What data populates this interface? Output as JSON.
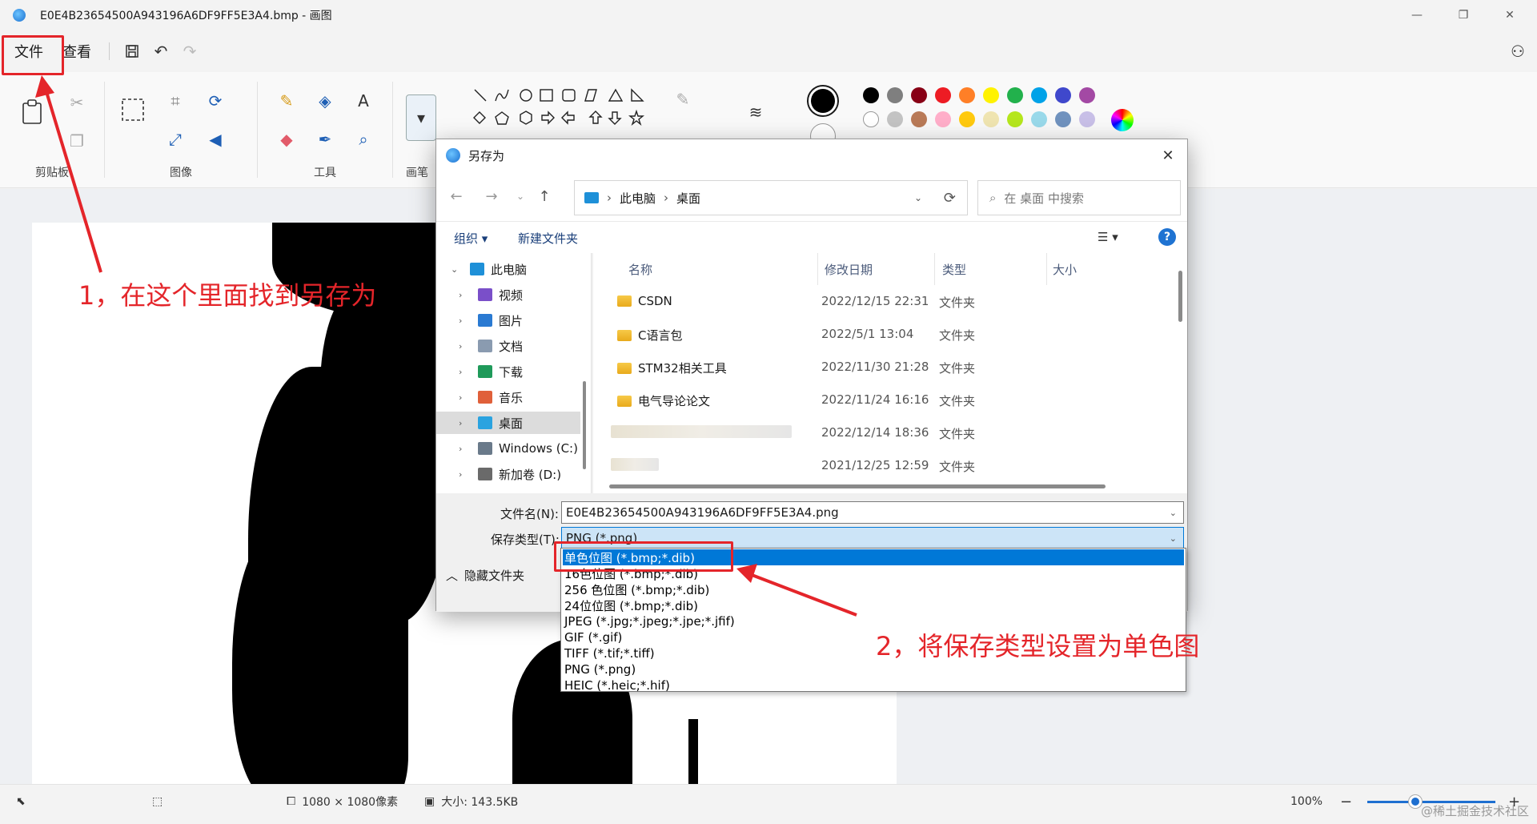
{
  "window": {
    "title": "E0E4B23654500A943196A6DF9FF5E3A4.bmp - 画图",
    "controls": {
      "minimize": "—",
      "maximize": "❐",
      "close": "✕"
    }
  },
  "menu": {
    "file": "文件",
    "view": "查看"
  },
  "ribbon": {
    "groups": {
      "clipboard": "剪贴板",
      "image": "图像",
      "tools": "工具",
      "brushes": "画笔"
    },
    "colors": {
      "row1": [
        "#000000",
        "#7f7f7f",
        "#880015",
        "#ed1c24",
        "#ff7f27",
        "#fff200",
        "#22b14c",
        "#00a2e8",
        "#3f48cc",
        "#a349a4"
      ],
      "row2": [
        "#ffffff",
        "#c3c3c3",
        "#b97a57",
        "#ffaec9",
        "#ffc90e",
        "#efe4b0",
        "#b5e61d",
        "#99d9ea",
        "#7092be",
        "#c8bfe7"
      ]
    }
  },
  "dialog": {
    "title": "另存为",
    "breadcrumb": [
      "此电脑",
      "桌面"
    ],
    "search_placeholder": "在 桌面 中搜索",
    "toolbar": {
      "organize": "组织 ▾",
      "new_folder": "新建文件夹"
    },
    "tree": [
      {
        "label": "此电脑",
        "color": "#1e90d8"
      },
      {
        "label": "视频",
        "color": "#7a4fc9"
      },
      {
        "label": "图片",
        "color": "#2a7ad2"
      },
      {
        "label": "文档",
        "color": "#8a9bb0"
      },
      {
        "label": "下载",
        "color": "#1f9a5a"
      },
      {
        "label": "音乐",
        "color": "#e0603a"
      },
      {
        "label": "桌面",
        "color": "#2aa3e0"
      },
      {
        "label": "Windows (C:)",
        "color": "#6a7a8a"
      },
      {
        "label": "新加卷 (D:)",
        "color": "#6a6a6a"
      }
    ],
    "columns": {
      "name": "名称",
      "modified": "修改日期",
      "type": "类型",
      "size": "大小"
    },
    "files": [
      {
        "name": "CSDN",
        "modified": "2022/12/15 22:31",
        "type": "文件夹"
      },
      {
        "name": "C语言包",
        "modified": "2022/5/1 13:04",
        "type": "文件夹"
      },
      {
        "name": "STM32相关工具",
        "modified": "2022/11/30 21:28",
        "type": "文件夹"
      },
      {
        "name": "电气导论论文",
        "modified": "2022/11/24 16:16",
        "type": "文件夹"
      },
      {
        "name": "",
        "modified": "2022/12/14 18:36",
        "type": "文件夹"
      },
      {
        "name": "",
        "modified": "2021/12/25 12:59",
        "type": "文件夹"
      }
    ],
    "filename_label": "文件名(N):",
    "filename_value": "E0E4B23654500A943196A6DF9FF5E3A4.png",
    "filetype_label": "保存类型(T):",
    "filetype_value": "PNG (*.png)",
    "hide_folders": "隐藏文件夹",
    "filetype_options": [
      "单色位图 (*.bmp;*.dib)",
      "16色位图 (*.bmp;*.dib)",
      "256 色位图 (*.bmp;*.dib)",
      "24位位图 (*.bmp;*.dib)",
      "JPEG (*.jpg;*.jpeg;*.jpe;*.jfif)",
      "GIF (*.gif)",
      "TIFF (*.tif;*.tiff)",
      "PNG (*.png)",
      "HEIC (*.heic;*.hif)"
    ]
  },
  "status": {
    "dimensions": "1080 × 1080像素",
    "size": "大小: 143.5KB",
    "zoom": "100%"
  },
  "annotations": {
    "step1": "1，在这个里面找到另存为",
    "step2": "2，将保存类型设置为单色图",
    "color": "#e4252a"
  },
  "watermark": "@稀土掘金技术社区"
}
